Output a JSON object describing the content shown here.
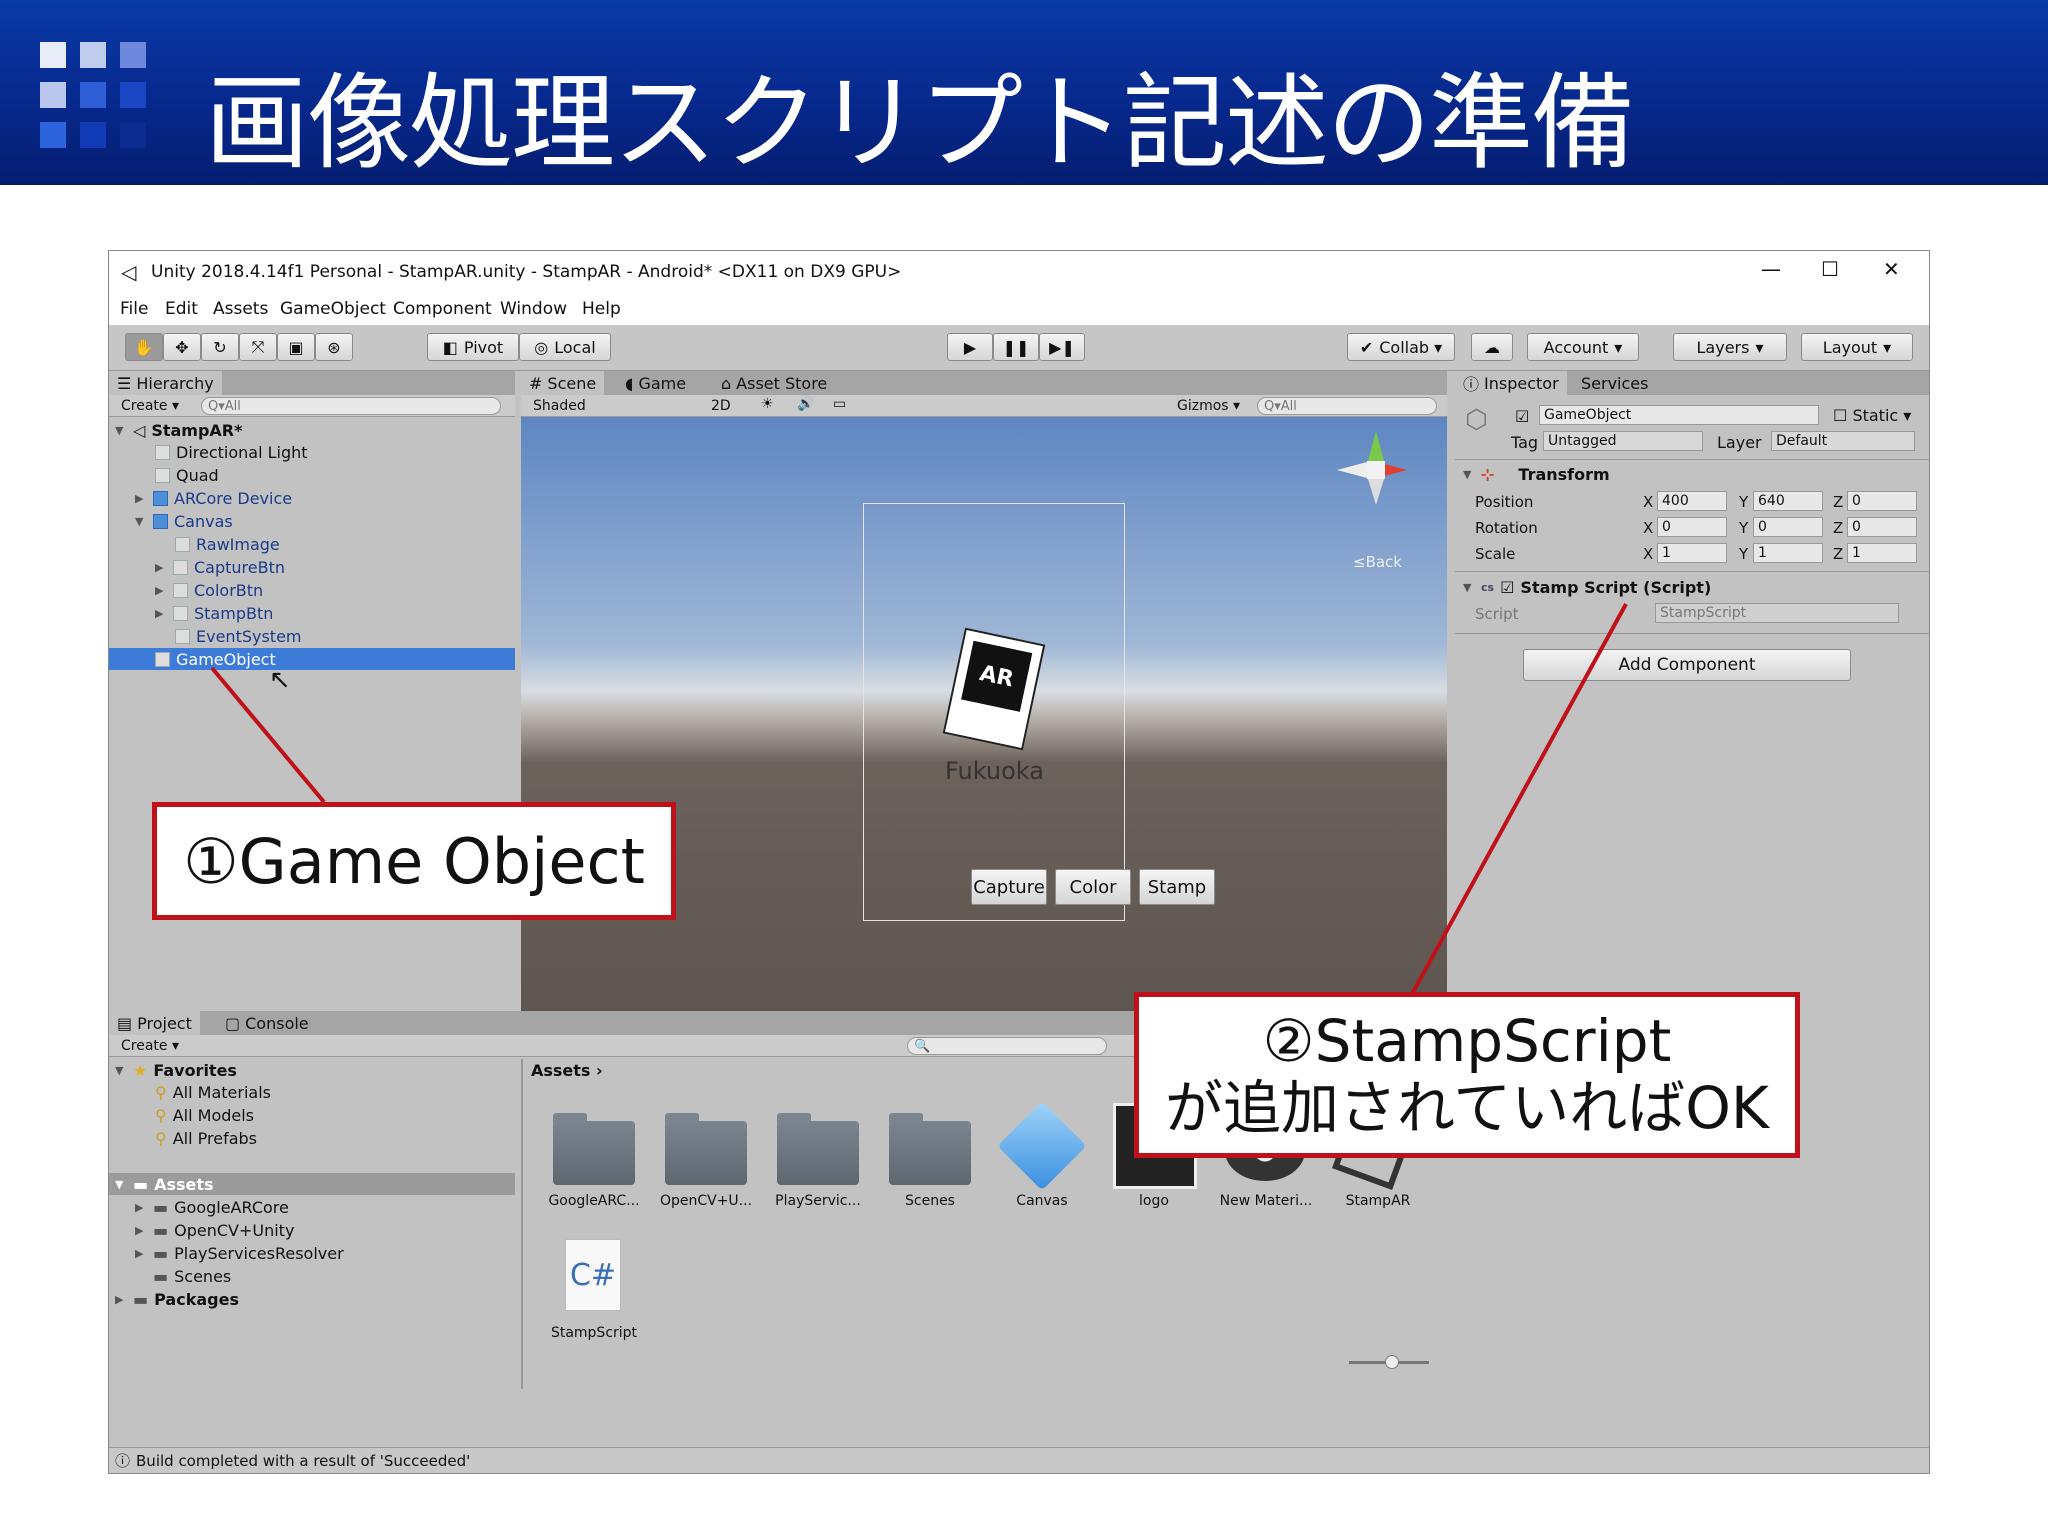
{
  "slide": {
    "title": "画像処理スクリプト記述の準備",
    "callout1": "①Game Object",
    "callout2_line1": "②StampScript",
    "callout2_line2": "が追加されていればOK"
  },
  "window": {
    "title": "Unity 2018.4.14f1 Personal - StampAR.unity - StampAR - Android* <DX11 on DX9 GPU>",
    "controls": [
      "—",
      "☐",
      "✕"
    ]
  },
  "menu": [
    "File",
    "Edit",
    "Assets",
    "GameObject",
    "Component",
    "Window",
    "Help"
  ],
  "toolbar": {
    "pivot": "Pivot",
    "local": "Local",
    "collab": "Collab ▾",
    "account": "Account",
    "layers": "Layers",
    "layout": "Layout"
  },
  "hierarchy": {
    "tab": "Hierarchy",
    "create": "Create ▾",
    "search": "Q▾All",
    "scene": "StampAR*",
    "items": [
      {
        "label": "Directional Light"
      },
      {
        "label": "Quad"
      },
      {
        "label": "ARCore Device"
      },
      {
        "label": "Canvas"
      },
      {
        "label": "RawImage"
      },
      {
        "label": "CaptureBtn"
      },
      {
        "label": "ColorBtn"
      },
      {
        "label": "StampBtn"
      },
      {
        "label": "EventSystem"
      },
      {
        "label": "GameObject"
      }
    ]
  },
  "scene": {
    "tab_scene": "Scene",
    "tab_game": "Game",
    "tab_store": "Asset Store",
    "shaded": "Shaded",
    "mode2d": "2D",
    "gizmos": "Gizmos ▾",
    "search": "Q▾All",
    "back": "≤Back",
    "marker_text": "AR",
    "marker_sub": "Fukuoka",
    "buttons": [
      "Capture",
      "Color",
      "Stamp"
    ]
  },
  "inspector": {
    "tab": "Inspector",
    "services": "Services",
    "object_name": "GameObject",
    "static": "Static",
    "tag_label": "Tag",
    "tag": "Untagged",
    "layer_label": "Layer",
    "layer": "Default",
    "transform": "Transform",
    "position": {
      "label": "Position",
      "x": "400",
      "y": "640",
      "z": "0"
    },
    "rotation": {
      "label": "Rotation",
      "x": "0",
      "y": "0",
      "z": "0"
    },
    "scale": {
      "label": "Scale",
      "x": "1",
      "y": "1",
      "z": "1"
    },
    "axis_x": "X",
    "axis_y": "Y",
    "axis_z": "Z",
    "component": "Stamp Script (Script)",
    "script_label": "Script",
    "script_value": "StampScript",
    "add_component": "Add Component"
  },
  "project": {
    "tab_project": "Project",
    "tab_console": "Console",
    "create": "Create ▾",
    "favorites": "Favorites",
    "fav_items": [
      "All Materials",
      "All Models",
      "All Prefabs"
    ],
    "assets": "Assets",
    "asset_folders": [
      "GoogleARCore",
      "OpenCV+Unity",
      "PlayServicesResolver",
      "Scenes"
    ],
    "packages": "Packages",
    "breadcrumb": "Assets",
    "asset_items": [
      "GoogleARC...",
      "OpenCV+U...",
      "PlayServic...",
      "Scenes",
      "Canvas",
      "logo",
      "New Materi...",
      "StampAR"
    ],
    "script_item": "StampScript",
    "script_glyph": "C#"
  },
  "status": "Build completed with a result of 'Succeeded'"
}
